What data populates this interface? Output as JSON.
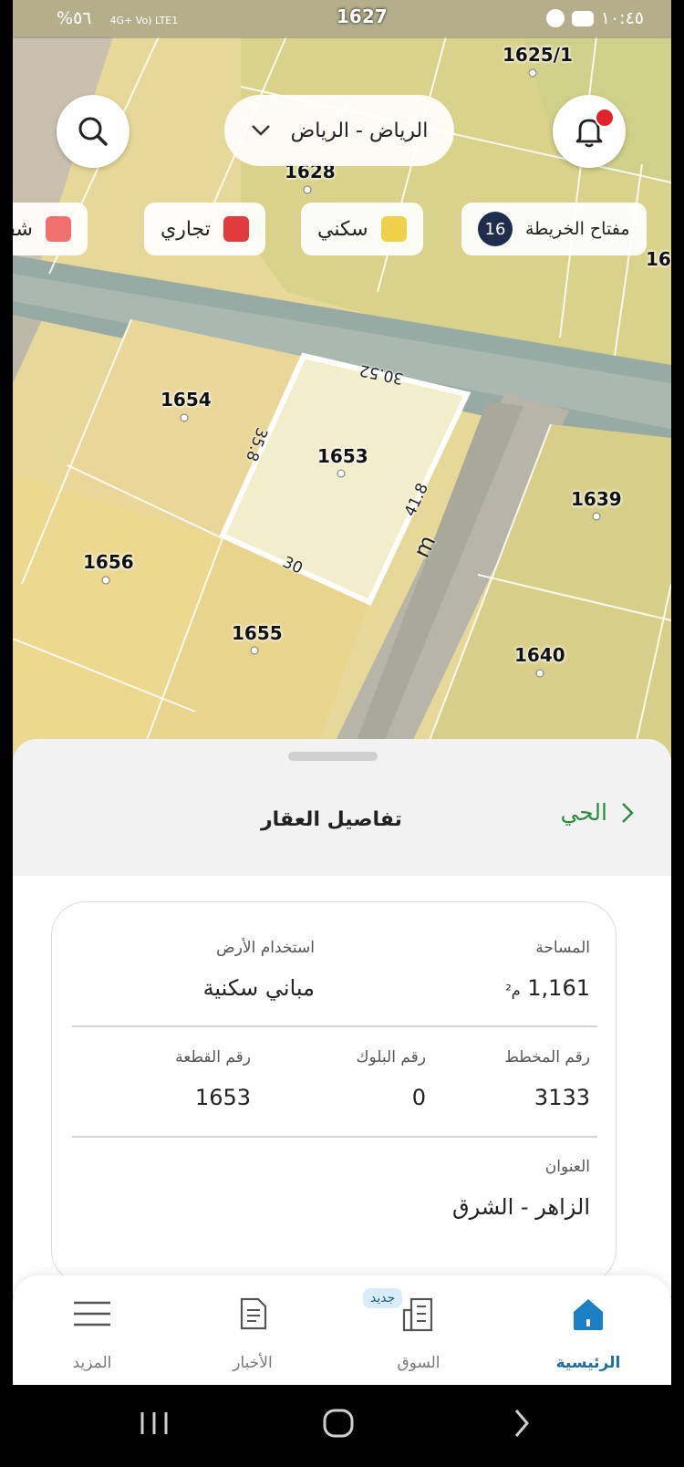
{
  "status_bar": {
    "time": "١٠:٤٥",
    "battery": "%٥٦",
    "network": "4G+ Vo) LTE1",
    "center_plot": "1627"
  },
  "map": {
    "plots": [
      {
        "id": "p1625",
        "label": "1625/1"
      },
      {
        "id": "p1628",
        "label": "1628"
      },
      {
        "id": "p1654",
        "label": "1654"
      },
      {
        "id": "p1653",
        "label": "1653"
      },
      {
        "id": "p1639",
        "label": "1639"
      },
      {
        "id": "p1656",
        "label": "1656"
      },
      {
        "id": "p1655",
        "label": "1655"
      },
      {
        "id": "p1640",
        "label": "1640"
      },
      {
        "id": "p16",
        "label": "16"
      }
    ],
    "dimensions": {
      "top": "30.52",
      "left": "35.8",
      "right": "41.8",
      "bottom": "30",
      "unit": "m"
    },
    "colors": {
      "residential": "#f0cf4a",
      "commercial": "#e23b3b",
      "apartments": "#f07070",
      "road": "#8fa3a0",
      "selected_border": "#ffffff"
    }
  },
  "city_selector": {
    "label": "الرياض - الرياض"
  },
  "legend": {
    "key_label": "مفتاح الخريطة",
    "badge": "16",
    "chips": [
      {
        "label": "سكني"
      },
      {
        "label": "تجاري"
      },
      {
        "label": "شقق"
      }
    ]
  },
  "sheet": {
    "title": "تفاصيل العقار",
    "back_label": "الحي",
    "area_label": "المساحة",
    "area_value": "1,161",
    "area_unit": "م²",
    "land_use_label": "استخدام الأرض",
    "land_use_value": "مباني سكنية",
    "plan_label": "رقم المخطط",
    "plan_value": "3133",
    "block_label": "رقم البلوك",
    "block_value": "0",
    "plot_label": "رقم القطعة",
    "plot_value": "1653",
    "address_label": "العنوان",
    "address_value": "الزاهر - الشرق"
  },
  "bottom_nav": {
    "home": "الرئيسية",
    "market": "السوق",
    "market_badge": "جديد",
    "news": "الأخبار",
    "more": "المزيد"
  }
}
